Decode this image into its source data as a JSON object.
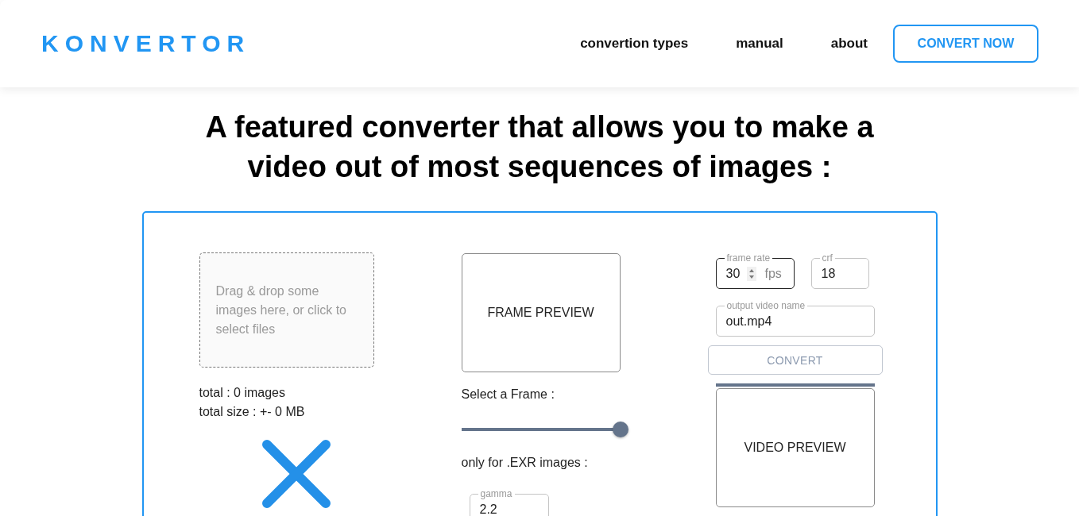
{
  "header": {
    "logo": "KONVERTOR",
    "nav_links": [
      "convertion types",
      "manual",
      "about"
    ],
    "cta_button": "CONVERT NOW"
  },
  "heading": "A featured converter that allows you to make a video out of most sequences of images :",
  "converter": {
    "dropzone": {
      "text": "Drag & drop some images here, or click to select files"
    },
    "stats": [
      "total : 0 images",
      "total size : +- 0 MB"
    ],
    "frame_preview": "FRAME PREVIEW",
    "frame_slider": {
      "label": "Select a Frame :",
      "level": 1
    },
    "exr_note": "only for .EXR images :",
    "gamma_field": {
      "label": "gamma",
      "value": "2.2",
      "focused": false
    },
    "settings_fields": [
      {
        "label": "frame rate",
        "value": "30",
        "suffix": "fps",
        "kind": "stepper",
        "focused": true
      },
      {
        "label": "crf",
        "value": "18",
        "kind": "plain",
        "focused": false
      }
    ],
    "output_field": {
      "label": "output video name",
      "value": "out.mp4",
      "focused": false
    },
    "convert_button": {
      "label": "CONVERT",
      "disabled": true
    },
    "progress": {
      "level": 1
    },
    "video_preview": "VIDEO PREVIEW"
  }
}
